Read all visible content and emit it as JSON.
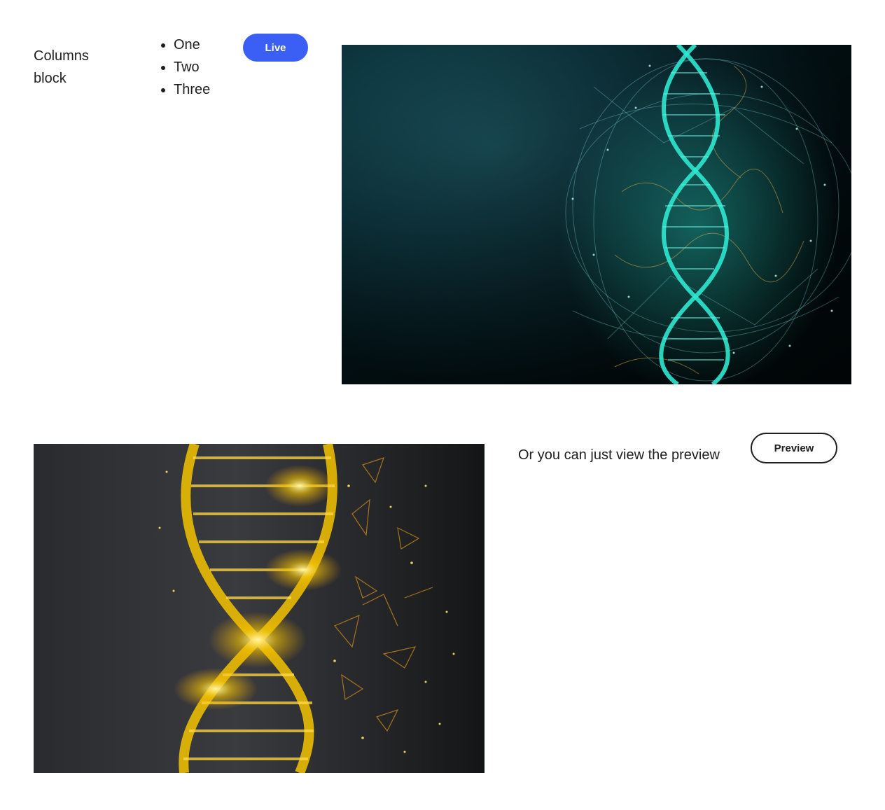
{
  "columns_block": {
    "label": "Columns block",
    "list_items": [
      "One",
      "Two",
      "Three"
    ],
    "live_button_label": "Live",
    "live_button_color": "#3b5ff5"
  },
  "media_text_block": {
    "text": "Or you can just view the preview",
    "preview_button_label": "Preview"
  },
  "images": {
    "top": "dna-helix-teal-image",
    "bottom": "dna-helix-gold-image"
  }
}
